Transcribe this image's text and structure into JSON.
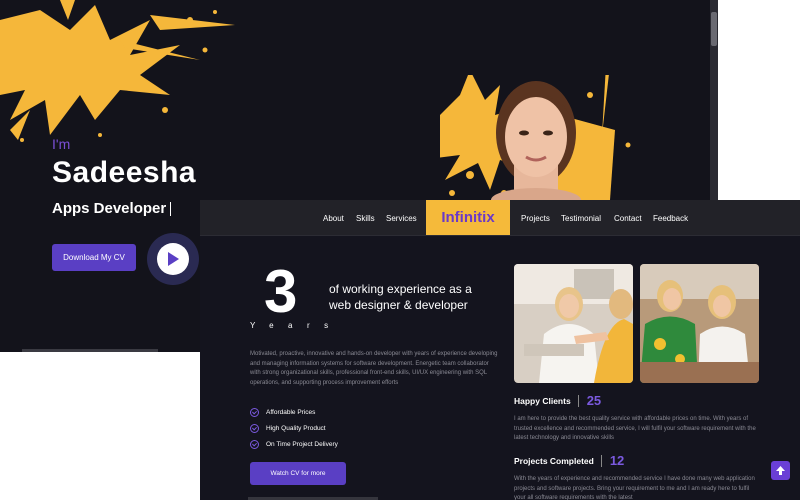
{
  "hero": {
    "greeting": "I'm",
    "name": "Sadeesha",
    "role": "Apps Developer",
    "download_cv": "Download My CV",
    "play_icon": "play-icon"
  },
  "nav": {
    "items_left": [
      "About",
      "Skills",
      "Services"
    ],
    "brand": "Infinitix",
    "items_right": [
      "Projects",
      "Testimonial",
      "Contact",
      "Feedback"
    ]
  },
  "experience": {
    "number": "3",
    "unit": "Years",
    "headline": "of working experience as a web designer & developer",
    "description": "Motivated, proactive, innovative and hands-on developer with years of experience developing and managing information systems for software development. Energetic team collaborator with strong organizational skills, professional front-end skills, UI/UX engineering with SQL operations, and supporting process improvement efforts",
    "features": [
      "Affordable Prices",
      "High Quality Product",
      "On Time Project Delivery"
    ],
    "watch_cv": "Watch CV for more"
  },
  "stats": {
    "clients_label": "Happy Clients",
    "clients_value": "25",
    "clients_text": "I am here to provide the best quality service with affordable prices on time. With years of trusted excellence and recommended service, I will fulfil your software requirement with the latest technology and innovative skills",
    "projects_label": "Projects Completed",
    "projects_value": "12",
    "projects_text": "With the years of experience and recommended service I have done many web application projects and software projects. Bring your requirement to me and I am ready here to fulfil your all software requirements with the latest"
  },
  "colors": {
    "accent": "#5a3fc4",
    "brand_bg": "#f5ba3a",
    "brand_text": "#6a39c9",
    "background": "#14141e",
    "splash": "#f5b73a"
  }
}
